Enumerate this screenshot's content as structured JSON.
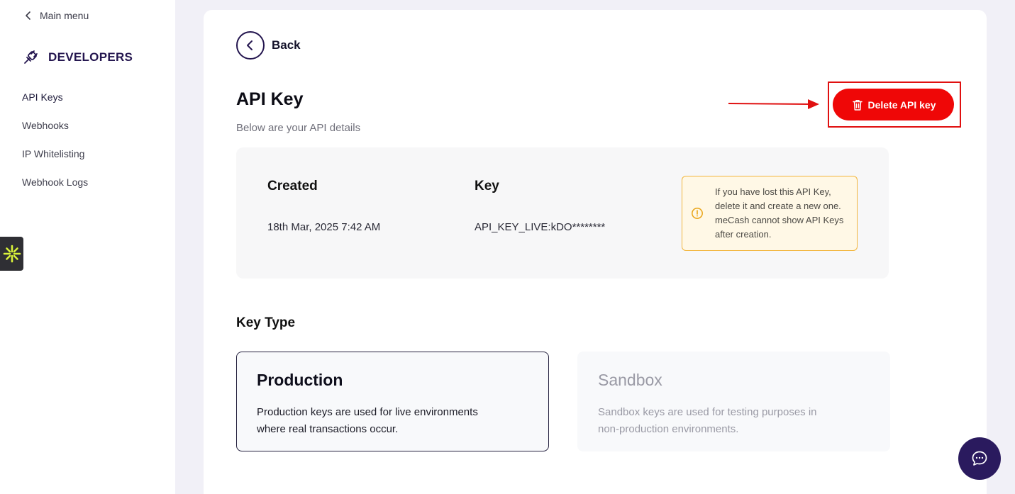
{
  "sidebar": {
    "main_menu_label": "Main menu",
    "section_title": "DEVELOPERS",
    "items": [
      {
        "label": "API Keys",
        "active": true
      },
      {
        "label": "Webhooks",
        "active": false
      },
      {
        "label": "IP Whitelisting",
        "active": false
      },
      {
        "label": "Webhook Logs",
        "active": false
      }
    ]
  },
  "header": {
    "back_label": "Back",
    "title": "API Key",
    "subtitle": "Below are your API details",
    "delete_label": "Delete API key"
  },
  "details": {
    "created_heading": "Created",
    "created_value": "18th Mar, 2025 7:42 AM",
    "key_heading": "Key",
    "key_value": "API_KEY_LIVE:kDO********",
    "notice": "If you have lost this API Key, delete it and create a new one. meCash cannot show API Keys after creation."
  },
  "key_type": {
    "label": "Key Type",
    "options": [
      {
        "title": "Production",
        "description": "Production keys are used for live environments where real transactions occur.",
        "selected": true
      },
      {
        "title": "Sandbox",
        "description": "Sandbox keys are used for testing purposes in non-production environments.",
        "selected": false
      }
    ]
  },
  "icons": {
    "back": "chevron-left-icon",
    "developers": "plug-icon",
    "delete": "trash-icon",
    "notice": "warning-icon",
    "chat": "chat-icon",
    "widget": "sparkle-icon"
  },
  "colors": {
    "brand": "#24164f",
    "danger": "#ef0707",
    "annotation": "#e01010",
    "notice_border": "#f2b53c",
    "chat_bg": "#2a1a5e"
  }
}
